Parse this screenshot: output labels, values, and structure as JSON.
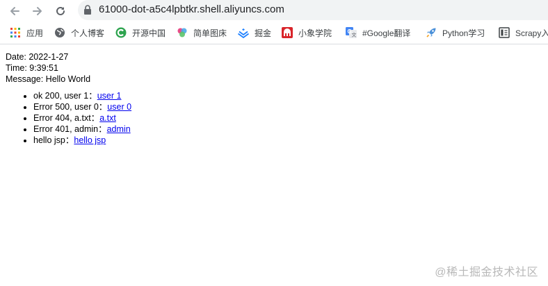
{
  "browser": {
    "url": "61000-dot-a5c4lpbtkr.shell.aliyuncs.com",
    "bookmarks": [
      {
        "label": "应用",
        "icon": "apps-grid-icon"
      },
      {
        "label": "个人博客",
        "icon": "globe-icon"
      },
      {
        "label": "开源中国",
        "icon": "oschina-icon"
      },
      {
        "label": "简单图床",
        "icon": "image-host-icon"
      },
      {
        "label": "掘金",
        "icon": "juejin-icon"
      },
      {
        "label": "小象学院",
        "icon": "elephant-icon"
      },
      {
        "label": "#Google翻译",
        "icon": "google-translate-icon"
      },
      {
        "label": "Python学习",
        "icon": "rocket-icon"
      },
      {
        "label": "Scrapy入",
        "icon": "book-icon"
      }
    ]
  },
  "page": {
    "date": "Date: 2022-1-27",
    "time": "Time: 9:39:51",
    "message": "Message: Hello World",
    "items": [
      {
        "text": "ok 200, user 1：",
        "link": "user 1"
      },
      {
        "text": "Error 500, user 0：",
        "link": "user 0"
      },
      {
        "text": "Error 404, a.txt：",
        "link": "a.txt"
      },
      {
        "text": "Error 401, admin：",
        "link": "admin"
      },
      {
        "text": "hello jsp：",
        "link": "hello jsp"
      }
    ]
  },
  "watermark": "@稀土掘金技术社区",
  "colors": {
    "link": "#0000ee",
    "omnibox": "#f1f3f4",
    "watermark": "#b8b8b8"
  }
}
